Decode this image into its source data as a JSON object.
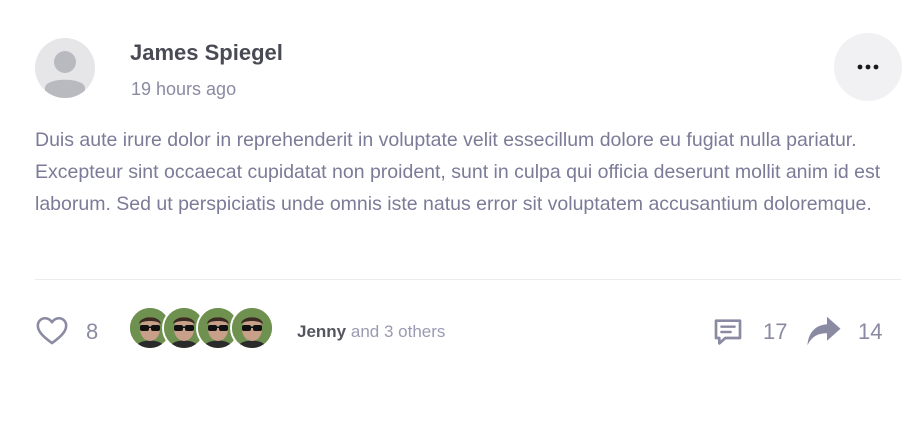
{
  "post": {
    "author": "James Spiegel",
    "timestamp": "19 hours ago",
    "body": "Duis aute irure dolor in reprehenderit in voluptate velit essecillum dolore eu fugiat nulla pariatur. Excepteur sint occaecat cupidatat non proident, sunt in culpa qui officia deserunt mollit anim id est laborum. Sed ut perspiciatis unde omnis iste natus error sit voluptatem accusantium doloremque.",
    "more_icon": "more-horizontal-icon"
  },
  "reactions": {
    "like_icon": "heart-icon",
    "like_count": "8",
    "liker_count_shown": 4,
    "first_liker": "Jenny",
    "others_text": "and 3 others",
    "comment_icon": "comment-icon",
    "comment_count": "17",
    "share_icon": "share-icon",
    "share_count": "14"
  },
  "colors": {
    "accent": "#8a8aa3",
    "text_dark": "#4a4a55",
    "body_text": "#7b7b98",
    "divider": "#ececf0"
  }
}
